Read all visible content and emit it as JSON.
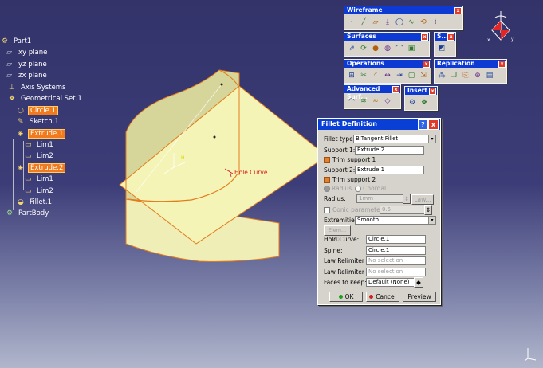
{
  "tree": {
    "items": [
      {
        "label": "Part1",
        "icon": "part-icon"
      },
      {
        "label": "xy plane",
        "icon": "plane-icon"
      },
      {
        "label": "yz plane",
        "icon": "plane-icon"
      },
      {
        "label": "zx plane",
        "icon": "plane-icon"
      },
      {
        "label": "Axis Systems",
        "icon": "axis-systems-icon"
      },
      {
        "label": "Geometrical Set.1",
        "icon": "geometrical-set-icon"
      },
      {
        "label": "Circle.1",
        "icon": "circle-icon"
      },
      {
        "label": "Sketch.1",
        "icon": "sketch-icon"
      },
      {
        "label": "Extrude.1",
        "icon": "extrude-icon"
      },
      {
        "label": "Lim1",
        "icon": "limit-icon"
      },
      {
        "label": "Lim2",
        "icon": "limit-icon"
      },
      {
        "label": "Extrude.2",
        "icon": "extrude-icon"
      },
      {
        "label": "Lim1",
        "icon": "limit-icon"
      },
      {
        "label": "Lim2",
        "icon": "limit-icon"
      },
      {
        "label": "Fillet.1",
        "icon": "fillet-icon"
      },
      {
        "label": "PartBody",
        "icon": "partbody-icon"
      }
    ]
  },
  "viewport": {
    "curve_label": "Hole Curve",
    "colors": {
      "surface": "#f2f2b0",
      "edge": "#e37c1c",
      "background_top": "#33336a",
      "background_bottom": "#b1b6cc"
    }
  },
  "toolbars": {
    "wireframe": {
      "title": "Wireframe",
      "close": "x",
      "icons": [
        "point-icon",
        "line-icon",
        "plane-icon",
        "projection-icon",
        "circle-icon",
        "spline-icon",
        "helix-icon",
        "polyline-icon"
      ]
    },
    "surfaces": {
      "title": "Surfaces",
      "close": "x",
      "icons": [
        "extrude-icon",
        "revolve-icon",
        "sphere-icon",
        "offset-icon",
        "sweep-icon",
        "fill-icon"
      ]
    },
    "s": {
      "title": "S...",
      "close": "x",
      "icons": [
        "surface-icon"
      ]
    },
    "operations": {
      "title": "Operations",
      "close": "x",
      "icons": [
        "join-icon",
        "split-icon",
        "fillet-icon",
        "translate-icon",
        "extrapolate-icon",
        "boundary-icon",
        "extract-icon"
      ]
    },
    "replication": {
      "title": "Replication",
      "close": "x",
      "icons": [
        "pattern-icon",
        "duplicate-icon",
        "powercopy-icon",
        "instantiate-icon",
        "catalog-icon"
      ]
    },
    "advanced_surfaces": {
      "title": "Advanced Surf...",
      "close": "x",
      "icons": [
        "bump-icon",
        "wrap-curve-icon",
        "wrap-surface-icon",
        "shape-morph-icon"
      ]
    },
    "insert": {
      "title": "Insert",
      "close": "x",
      "icons": [
        "body-icon",
        "geometrical-set-icon"
      ]
    }
  },
  "dialog": {
    "title": "Fillet Definition",
    "help_label": "?",
    "close_label": "x",
    "fillet_type_label": "Fillet type:",
    "fillet_type_value": "BiTangent Fillet",
    "support1_label": "Support 1:",
    "support1_value": "Extrude.2",
    "trim1_label": "Trim support 1",
    "support2_label": "Support 2:",
    "support2_value": "Extrude.1",
    "trim2_label": "Trim support 2",
    "radius_option": "Radius",
    "chordal_option": "Chordal",
    "radius_label": "Radius:",
    "radius_value": "1mm",
    "law_button": "Law...",
    "conic_label": "Conic parameter:",
    "conic_value": "0.5",
    "extremities_label": "Extremities:",
    "extremities_value": "Smooth",
    "elements_button": "Elem... >>",
    "hold_curve_label": "Hold Curve:",
    "hold_curve_value": "Circle.1",
    "spine_label": "Spine:",
    "spine_value": "Circle.1",
    "law_relimiter1_label": "Law Relimiter 1:",
    "law_relimiter1_value": "No selection",
    "law_relimiter2_label": "Law Relimiter 2:",
    "law_relimiter2_value": "No selection",
    "faces_to_keep_label": "Faces to keep:",
    "faces_to_keep_value": "Default (None)",
    "ok_label": "OK",
    "cancel_label": "Cancel",
    "preview_label": "Preview"
  }
}
